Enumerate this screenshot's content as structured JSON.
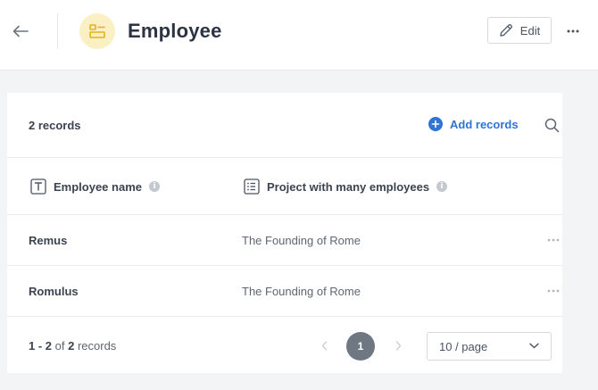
{
  "header": {
    "title": "Employee",
    "edit_label": "Edit"
  },
  "toolbar": {
    "records_count": "2 records",
    "add_records_label": "Add records"
  },
  "table": {
    "columns": [
      {
        "label": "Employee name",
        "icon": "text-field-icon"
      },
      {
        "label": "Project with many employees",
        "icon": "list-field-icon"
      }
    ],
    "rows": [
      {
        "name": "Remus",
        "project": "The Founding of Rome"
      },
      {
        "name": "Romulus",
        "project": "The Founding of Rome"
      }
    ]
  },
  "pagination": {
    "range_start": "1",
    "range_sep": " - ",
    "range_end": "2",
    "of_text": " of ",
    "total": "2",
    "records_word": " records",
    "current_page": "1",
    "page_size_label": "10 / page"
  },
  "colors": {
    "accent": "#2f74d6",
    "avatar_bg": "#fbefc4",
    "avatar_icon": "#e3b21c",
    "page_active": "#6f7782"
  }
}
